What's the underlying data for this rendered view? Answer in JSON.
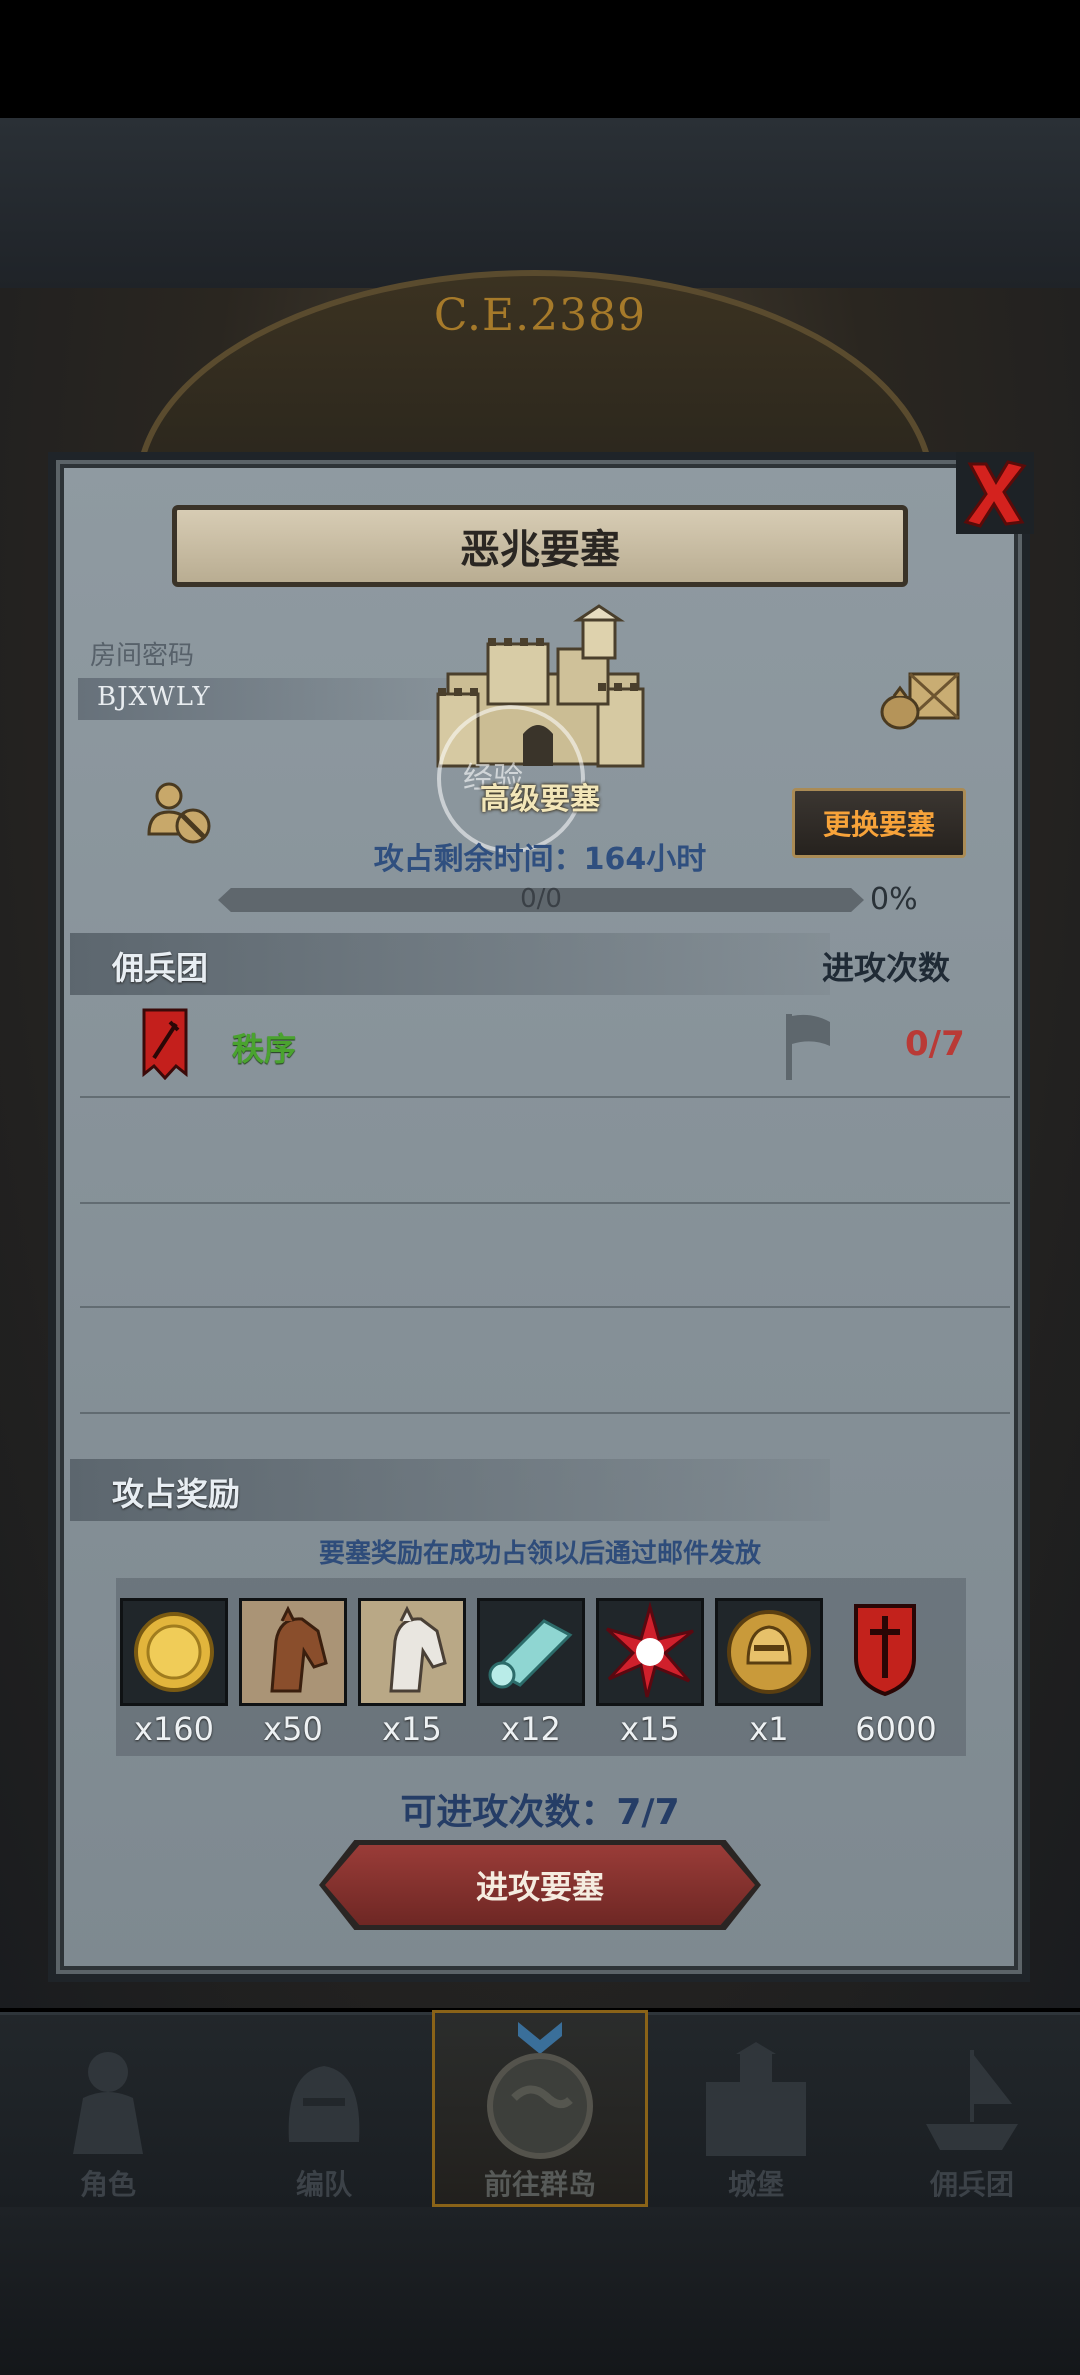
{
  "header": {
    "era": "C.E.2389"
  },
  "dialog": {
    "title": "恶兆要塞",
    "room_label": "房间密码",
    "room_code": "BJXWLY",
    "fortress_type": "高级要塞",
    "exp_overlay": "经验",
    "change_button": "更换要塞",
    "time_remaining": "攻占剩余时间：164小时",
    "progress": {
      "text": "0/0",
      "percent_text": "0%",
      "value": 0
    },
    "mercenary_header": "佣兵团",
    "attack_count_header": "进攻次数",
    "mercenaries": [
      {
        "name": "秩序",
        "attacks": "0/7"
      }
    ],
    "reward_header": "攻占奖励",
    "reward_note": "要塞奖励在成功占领以后通过邮件发放",
    "rewards": [
      {
        "icon": "gold-coin-icon",
        "qty": "x160"
      },
      {
        "icon": "brown-horse-icon",
        "qty": "x50"
      },
      {
        "icon": "white-horse-icon",
        "qty": "x15"
      },
      {
        "icon": "cloth-roll-icon",
        "qty": "x12"
      },
      {
        "icon": "red-burst-icon",
        "qty": "x15"
      },
      {
        "icon": "helmet-medal-icon",
        "qty": "x1"
      },
      {
        "icon": "guild-crest-icon",
        "qty": "6000"
      }
    ],
    "attempts": "可进攻次数：7/7",
    "attack_button": "进攻要塞"
  },
  "nav": {
    "items": [
      {
        "label": "角色",
        "icon": "knight-icon"
      },
      {
        "label": "编队",
        "icon": "helmet-icon"
      },
      {
        "label": "前往群岛",
        "icon": "globe-icon"
      },
      {
        "label": "城堡",
        "icon": "castle-icon"
      },
      {
        "label": "佣兵团",
        "icon": "ship-icon"
      }
    ]
  },
  "colors": {
    "accent": "#f7a33a",
    "guild_green": "#4aa32f",
    "count_red": "#b93a36",
    "panel": "#88939a"
  }
}
